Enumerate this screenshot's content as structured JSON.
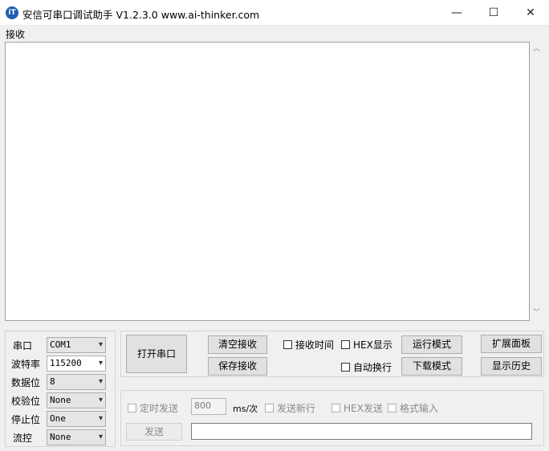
{
  "window": {
    "title": "安信可串口调试助手 V1.2.3.0     www.ai-thinker.com",
    "icon_text": "iT",
    "controls": {
      "minimize": "—",
      "maximize": "☐",
      "close": "✕"
    }
  },
  "receive": {
    "label": "接收"
  },
  "serial_settings": {
    "port": {
      "label": "串口",
      "value": "COM1"
    },
    "baud": {
      "label": "波特率",
      "value": "115200"
    },
    "data_bits": {
      "label": "数据位",
      "value": "8"
    },
    "parity": {
      "label": "校验位",
      "value": "None"
    },
    "stop_bits": {
      "label": "停止位",
      "value": "One"
    },
    "flow": {
      "label": "流控",
      "value": "None"
    }
  },
  "actions": {
    "open_port": "打开串口",
    "clear_recv": "清空接收",
    "save_recv": "保存接收",
    "recv_time": "接收时间",
    "hex_display": "HEX显示",
    "auto_wrap": "自动换行",
    "run_mode": "运行模式",
    "download_mode": "下载模式",
    "expand_panel": "扩展面板",
    "show_history": "显示历史"
  },
  "send": {
    "timed_send": "定时发送",
    "interval_value": "800",
    "interval_unit": "ms/次",
    "send_newline": "发送新行",
    "hex_send": "HEX发送",
    "format_input": "格式输入",
    "send_button": "发送"
  },
  "icons": {
    "dropdown": "▾",
    "scroll_up": "︿",
    "scroll_down": "﹀"
  }
}
